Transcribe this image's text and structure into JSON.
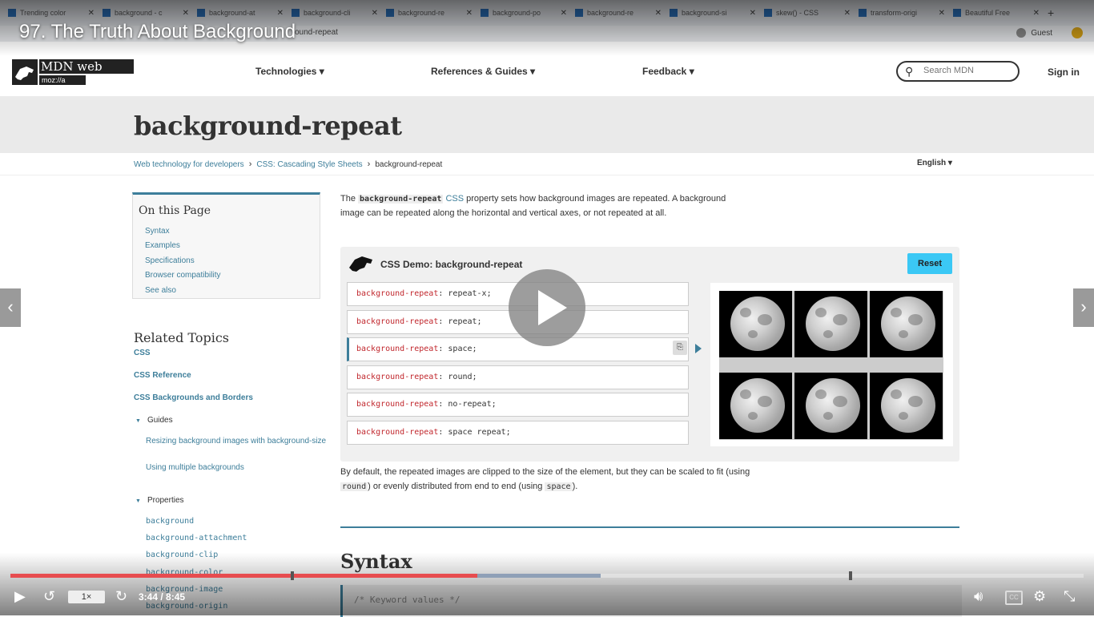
{
  "browser": {
    "tabs": [
      "Trending color",
      "background - c",
      "background-at",
      "background-cli",
      "background-re",
      "background-po",
      "background-re",
      "background-si",
      "skew() - CSS",
      "transform-origi",
      "Beautiful Free"
    ],
    "address_fragment": "ound-repeat",
    "profile_label": "Guest"
  },
  "video": {
    "title": "97. The Truth About Background",
    "speed": "1×",
    "time": "3:44 / 8:45",
    "progress_played_pct": 43.5,
    "progress_buffered_pct": 55.0,
    "icons": {
      "play": "play-icon",
      "replay": "replay-icon",
      "forward": "forward-icon",
      "volume": "volume-icon",
      "captions": "CC",
      "settings": "gear-icon",
      "fullscreen": "exit-fullscreen-icon"
    }
  },
  "mdn": {
    "logo": {
      "top": "MDN web docs",
      "bottom": "moz://a"
    },
    "nav": [
      "Technologies ▾",
      "References & Guides ▾",
      "Feedback ▾"
    ],
    "search_placeholder": "Search MDN",
    "signin": "Sign in",
    "page_title": "background-repeat",
    "breadcrumb": [
      "Web technology for developers",
      "CSS: Cascading Style Sheets",
      "background-repeat"
    ],
    "language": "English ▾",
    "on_this_page": {
      "title": "On this Page",
      "links": [
        "Syntax",
        "Examples",
        "Specifications",
        "Browser compatibility",
        "See also"
      ]
    },
    "related": {
      "title": "Related Topics",
      "links": [
        "CSS",
        "CSS Reference",
        "CSS Backgrounds and Borders"
      ],
      "guides_label": "Guides",
      "guides": [
        "Resizing background images with background-size",
        "Using multiple backgrounds"
      ],
      "properties_label": "Properties",
      "properties": [
        "background",
        "background-attachment",
        "background-clip",
        "background-color",
        "background-image",
        "background-origin"
      ]
    },
    "intro": {
      "before": "The ",
      "code": "background-repeat",
      "link": "CSS",
      "after": " property sets how background images are repeated. A background image can be repeated along the horizontal and vertical axes, or not repeated at all."
    },
    "demo": {
      "title": "CSS Demo: background-repeat",
      "reset": "Reset",
      "options": [
        {
          "prop": "background-repeat",
          "val": "repeat-x;"
        },
        {
          "prop": "background-repeat",
          "val": "repeat;"
        },
        {
          "prop": "background-repeat",
          "val": "space;"
        },
        {
          "prop": "background-repeat",
          "val": "round;"
        },
        {
          "prop": "background-repeat",
          "val": "no-repeat;"
        },
        {
          "prop": "background-repeat",
          "val": "space repeat;"
        }
      ]
    },
    "after": {
      "t1": "By default, the repeated images are clipped to the size of the element, but they can be scaled to fit (using ",
      "c1": "round",
      "t2": ") or evenly distributed from end to end (using ",
      "c2": "space",
      "t3": ")."
    },
    "syntax_heading": "Syntax",
    "code_comment": "/* Keyword values */"
  }
}
